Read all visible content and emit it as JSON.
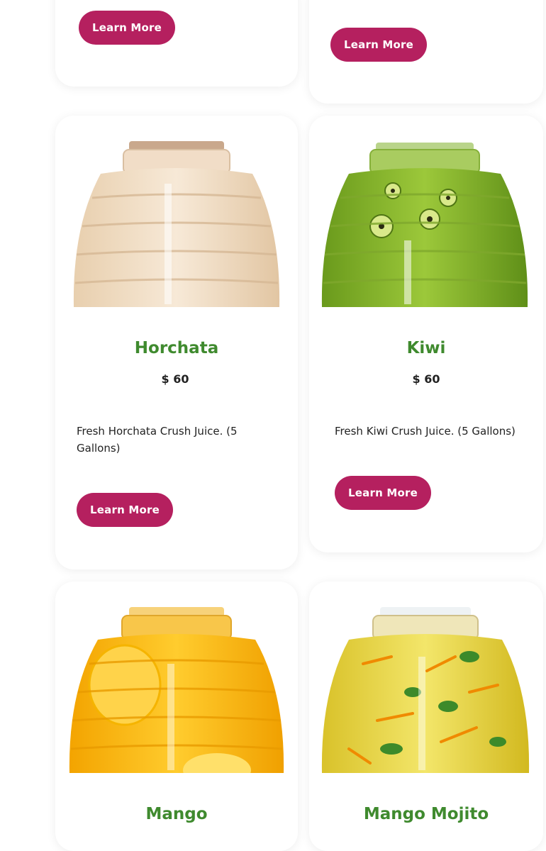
{
  "cards": [
    {
      "button_label": "Learn More"
    },
    {
      "button_label": "Learn More"
    },
    {
      "title": "Horchata",
      "price": "$ 60",
      "description": "Fresh Horchata Crush Juice. (5 Gallons)",
      "button_label": "Learn More",
      "image": "horchata-jar-image"
    },
    {
      "title": "Kiwi",
      "price": "$ 60",
      "description": "Fresh Kiwi Crush Juice. (5 Gallons)",
      "button_label": "Learn More",
      "image": "kiwi-jar-image"
    },
    {
      "title": "Mango",
      "image": "mango-jar-image"
    },
    {
      "title": "Mango Mojito",
      "image": "mango-mojito-jar-image"
    }
  ],
  "colors": {
    "accent": "#b5205f",
    "title_green": "#3f8a2e"
  }
}
